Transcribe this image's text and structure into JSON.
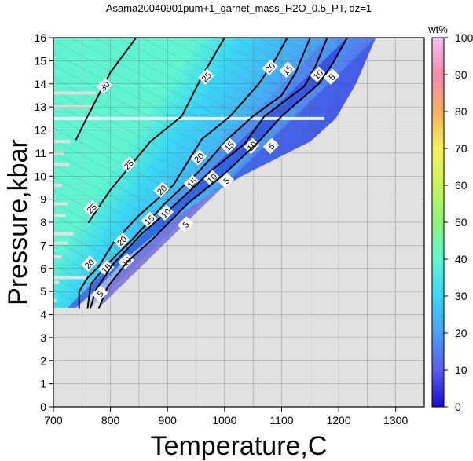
{
  "chart_data": {
    "type": "heatmap",
    "title": "Asama20040901pum+1_garnet_mass_H2O_0.5_PT, dz=1",
    "xlabel": "Temperature,C",
    "ylabel": "Pressure,kbar",
    "xlim": [
      700,
      1350
    ],
    "ylim": [
      0,
      16
    ],
    "xticks": [
      700,
      800,
      900,
      1000,
      1100,
      1200,
      1300
    ],
    "yticks": [
      0,
      1,
      2,
      3,
      4,
      5,
      6,
      7,
      8,
      9,
      10,
      11,
      12,
      13,
      14,
      15,
      16
    ],
    "grid": true,
    "colorbar": {
      "unit": "wt%",
      "range": [
        0,
        100
      ],
      "ticks": [
        0,
        10,
        20,
        30,
        40,
        50,
        60,
        70,
        80,
        90,
        100
      ],
      "colors": [
        "#1a0bd0",
        "#5a5cf0",
        "#4aa0f5",
        "#3ad7f5",
        "#60f5d0",
        "#8df57a",
        "#c8f55a",
        "#f5f05a",
        "#f5b060",
        "#f58ab0",
        "#f5c0f0"
      ]
    },
    "region": {
      "boundary_top": [
        [
          700,
          16
        ],
        [
          1265,
          16
        ]
      ],
      "high_T_edge": [
        [
          1265,
          16
        ],
        [
          1230,
          14
        ],
        [
          1195,
          12.5
        ],
        [
          1150,
          11.5
        ],
        [
          1030,
          10
        ],
        [
          930,
          8.5
        ],
        [
          830,
          6.5
        ],
        [
          780,
          5.2
        ],
        [
          740,
          4.3
        ],
        [
          725,
          4.3
        ]
      ]
    },
    "contours": [
      {
        "level": 30,
        "points": [
          [
            845,
            16
          ],
          [
            800,
            14.5
          ],
          [
            760,
            12.6
          ],
          [
            740,
            11.6
          ]
        ],
        "labels": [
          [
            790,
            13.9
          ]
        ]
      },
      {
        "level": 25,
        "points": [
          [
            1000,
            16
          ],
          [
            960,
            14.3
          ],
          [
            925,
            12.6
          ],
          [
            870,
            11.5
          ],
          [
            800,
            9.4
          ],
          [
            775,
            8.5
          ],
          [
            762,
            8
          ]
        ],
        "labels": [
          [
            968,
            14.3
          ],
          [
            832,
            10.5
          ],
          [
            767,
            8.6
          ]
        ]
      },
      {
        "level": 20,
        "points": [
          [
            1110,
            16
          ],
          [
            1090,
            15.1
          ],
          [
            1060,
            14
          ],
          [
            1010,
            12.6
          ],
          [
            960,
            11.6
          ],
          [
            910,
            9.6
          ],
          [
            850,
            8.3
          ],
          [
            805,
            7.1
          ],
          [
            780,
            6.1
          ],
          [
            760,
            5.6
          ],
          [
            745,
            5.0
          ],
          [
            745,
            4.3
          ]
        ],
        "labels": [
          [
            1080,
            14.7
          ],
          [
            955,
            10.8
          ],
          [
            890,
            9.4
          ],
          [
            820,
            7.2
          ],
          [
            763,
            6.2
          ]
        ]
      },
      {
        "level": 15,
        "points": [
          [
            1150,
            16
          ],
          [
            1125,
            14.5
          ],
          [
            1100,
            13.5
          ],
          [
            1050,
            12.6
          ],
          [
            1005,
            11.6
          ],
          [
            955,
            10.2
          ],
          [
            895,
            8.8
          ],
          [
            840,
            7.3
          ],
          [
            795,
            6.2
          ],
          [
            765,
            5.3
          ],
          [
            760,
            4.3
          ]
        ],
        "labels": [
          [
            1110,
            14.6
          ],
          [
            1008,
            11.3
          ],
          [
            943,
            9.7
          ],
          [
            868,
            8.1
          ],
          [
            793,
            6.0
          ]
        ]
      },
      {
        "level": 10,
        "points": [
          [
            1180,
            16
          ],
          [
            1160,
            14.8
          ],
          [
            1140,
            13.9
          ],
          [
            1070,
            12.6
          ],
          [
            1035,
            11.4
          ],
          [
            975,
            10.2
          ],
          [
            915,
            8.8
          ],
          [
            855,
            7.5
          ],
          [
            805,
            6.2
          ],
          [
            775,
            5.1
          ],
          [
            765,
            4.3
          ]
        ],
        "labels": [
          [
            1164,
            14.4
          ],
          [
            1048,
            11.3
          ],
          [
            978,
            9.9
          ],
          [
            897,
            8.4
          ],
          [
            828,
            6.3
          ]
        ]
      },
      {
        "level": 5,
        "points": [
          [
            1215,
            16
          ],
          [
            1190,
            14.9
          ],
          [
            1165,
            14
          ],
          [
            1100,
            12.6
          ],
          [
            1060,
            11.5
          ],
          [
            1000,
            10.1
          ],
          [
            935,
            8.8
          ],
          [
            875,
            7.3
          ],
          [
            830,
            6.3
          ],
          [
            795,
            5.2
          ],
          [
            780,
            4.3
          ]
        ],
        "labels": [
          [
            1188,
            14.3
          ],
          [
            1082,
            11.3
          ],
          [
            1003,
            9.8
          ],
          [
            932,
            7.9
          ],
          [
            782,
            4.9
          ]
        ]
      }
    ],
    "artifacts": {
      "white_bands": [
        [
          700,
          1175,
          12.5
        ]
      ],
      "gap_bands": [
        [
          700,
          775,
          13.6
        ],
        [
          700,
          770,
          13.0
        ],
        [
          700,
          730,
          11.5
        ],
        [
          700,
          718,
          11.0
        ],
        [
          700,
          728,
          10.5
        ],
        [
          700,
          715,
          9.6
        ],
        [
          700,
          725,
          8.8
        ],
        [
          700,
          722,
          8.3
        ],
        [
          700,
          735,
          7.5
        ],
        [
          700,
          725,
          7.1
        ],
        [
          700,
          715,
          6.5
        ],
        [
          700,
          760,
          5.6
        ],
        [
          700,
          710,
          5.4
        ],
        [
          700,
          705,
          4.6
        ]
      ]
    }
  }
}
